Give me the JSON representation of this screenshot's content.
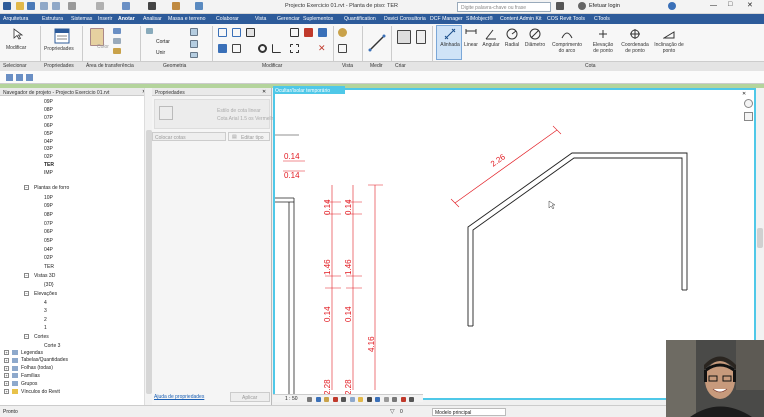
{
  "window": {
    "title": "Projecto Exercicio 01.rvt - Planta de piso: TER",
    "search_placeholder": "Digite palavra-chave ou frase",
    "login_label": "Efetuar login"
  },
  "menu": {
    "items": [
      "Arquitetura",
      "Estrutura",
      "Sistemas",
      "Inserir",
      "Anotar",
      "Analisar",
      "Massa e terreno",
      "Colaborar",
      "Vista",
      "Gerenciar",
      "Suplementos",
      "Quantification",
      "Davici Consultoria",
      "DCF Manager",
      "SIMobject®",
      "Content Admin Kit",
      "COS Revit Tools",
      "CTools"
    ]
  },
  "ribbon": {
    "modify_label": "Modificar",
    "properties_label": "Propriedades",
    "cut_label": "Cortar",
    "join_label": "Unir",
    "color_label": "Color",
    "measure_label": "Medir",
    "dim_buttons": [
      "Alinhada",
      "Linear",
      "Angular",
      "Radial",
      "Diâmetro",
      "Comprimento do arco",
      "Elevação de ponto",
      "Coordenada de ponto",
      "Inclinação de ponto"
    ],
    "panels": [
      "Selecionar",
      "Propriedades",
      "Área de transferência",
      "Geometria",
      "Modificar",
      "Vista",
      "Medir",
      "Criar",
      "Cota"
    ]
  },
  "navigator": {
    "title": "Navegador de projeto - Projecto Exercicio 01.rvt",
    "plantas_teto_items": [
      "09P",
      "08P",
      "07P",
      "06P",
      "05P",
      "04P",
      "03P",
      "02P",
      "TER",
      "IMP"
    ],
    "plantas_forro_label": "Plantas de forro",
    "plantas_forro_items": [
      "10P",
      "09P",
      "08P",
      "07P",
      "06P",
      "05P",
      "04P",
      "02P",
      "TER"
    ],
    "vistas3d_label": "Vistas 3D",
    "vistas3d_items": [
      "{3D}"
    ],
    "elevacoes_label": "Elevações",
    "elevacoes_items": [
      "4",
      "3",
      "2",
      "1"
    ],
    "cortes_label": "Cortes",
    "cortes_items": [
      "Corte 3"
    ],
    "other_items": [
      "Legendas",
      "Tabelas/Quantidades",
      "Folhas (todas)",
      "Famílias",
      "Grupos",
      "Vínculos do Revit"
    ]
  },
  "properties": {
    "title": "Propriedades",
    "type_line1": "Estilo de cota linear",
    "type_line2": "Cota Arial 1.5 os Vermelho",
    "dropdown_value": "Colocar cotas",
    "edit_type_label": "Editar tipo",
    "help_link": "Ajuda de propriedades",
    "apply_label": "Aplicar"
  },
  "viewport": {
    "tab_label": "Ocultar/Isolar temporário",
    "dims_left": [
      "0.14",
      "0.14"
    ],
    "dims_vertical": [
      "0.14",
      "1.46",
      "0.14",
      "2.28",
      "0.14",
      "1.46",
      "0.14",
      "2.28",
      "4.16"
    ],
    "dim_diagonal": "2.26",
    "scale": "1 : 50"
  },
  "status": {
    "left": "Pronto",
    "model": "Modelo principal",
    "count": "0"
  },
  "colors": {
    "accent": "#2d5b9a",
    "viewport_border": "#4fc8e8",
    "dimension": "#e21b22",
    "status_green": "#b4d49c"
  }
}
